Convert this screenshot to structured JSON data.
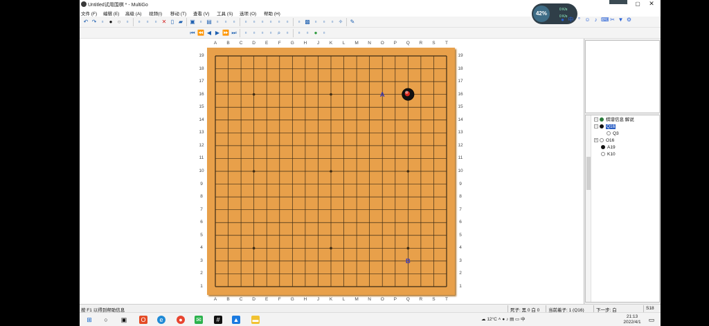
{
  "window": {
    "title": "Untitled试用围棋 * - MultiGo",
    "close_glyph": "✕"
  },
  "menu": [
    {
      "label": "文件 (F)"
    },
    {
      "label": "编辑 (E)"
    },
    {
      "label": "高级 (A)"
    },
    {
      "label": "视频(I)"
    },
    {
      "label": "移动 (T)"
    },
    {
      "label": "查看 (V)"
    },
    {
      "label": "工具 (S)"
    },
    {
      "label": "选项 (O)"
    },
    {
      "label": "帮助 (H)"
    }
  ],
  "toolbar1_icons": [
    "undo-icon",
    "redo-icon",
    "select-stone-icon",
    "black-stone-icon",
    "white-stone-icon",
    "alternate-icon",
    "erase-icon",
    "hand-icon",
    "mark-icon",
    "delete-icon",
    "new-icon",
    "open-icon",
    "save-icon",
    "save-as-icon",
    "print-icon",
    "print-preview-icon",
    "export-icon",
    "copy-icon",
    "paste-icon",
    "cut-icon",
    "puzzle-icon",
    "info-icon",
    "board-frame-icon",
    "board-grid-icon",
    "board-empty-icon",
    "lock-icon",
    "tree-view-icon",
    "list-view-icon",
    "split-view-icon",
    "tools-icon",
    "brush-icon"
  ],
  "toolbar2_icons": [
    "go-first-icon",
    "prev-10-icon",
    "prev-icon",
    "next-icon",
    "next-10-icon",
    "go-last-icon",
    "var-prev-icon",
    "var-next-icon",
    "var-up-icon",
    "var-down-icon",
    "find-icon",
    "find-next-icon",
    "find-prev-icon",
    "find-all-icon",
    "green-ball-icon",
    "settings-ball-icon"
  ],
  "board": {
    "size": 19,
    "columns": [
      "A",
      "B",
      "C",
      "D",
      "E",
      "F",
      "G",
      "H",
      "J",
      "K",
      "L",
      "M",
      "N",
      "O",
      "P",
      "Q",
      "R",
      "S",
      "T"
    ],
    "rows": [
      "19",
      "18",
      "17",
      "16",
      "15",
      "14",
      "13",
      "12",
      "11",
      "10",
      "9",
      "8",
      "7",
      "6",
      "5",
      "4",
      "3",
      "2",
      "1"
    ],
    "hoshi": [
      "D16",
      "K16",
      "Q16",
      "D10",
      "K10",
      "Q10",
      "D4",
      "K4",
      "Q4"
    ],
    "stones": [
      {
        "point": "Q16",
        "color": "black",
        "last_move": true
      }
    ],
    "labels": [
      {
        "point": "O16",
        "text": "A"
      },
      {
        "point": "Q3",
        "text": "B"
      }
    ],
    "line_color": "#3a2a15",
    "wood_color": "#e8a04a",
    "label_color": "#3d3ab8"
  },
  "tree": {
    "root": "棋谱信息 解说",
    "nodes": [
      {
        "label": "Q16",
        "stone": "black",
        "selected": true,
        "expanded": true
      },
      {
        "label": "Q3",
        "stone": "white",
        "child": true
      },
      {
        "label": "O16",
        "stone": "white",
        "expandable": true
      },
      {
        "label": "A19",
        "stone": "black"
      },
      {
        "label": "K10",
        "stone": "white"
      }
    ]
  },
  "status": {
    "help": "按 F1 以得到帮助信息",
    "captures": "死子: 黑 0 白 0",
    "current": "当前着子: 1 (Q16)",
    "next": "下一步: 白",
    "extra": "S18"
  },
  "overlay": {
    "cpu": "42%",
    "up": "0 K/s",
    "down": "0 K/s"
  },
  "taskbar": {
    "weather": "12°C",
    "time": "21:13",
    "date": "2022/4/1"
  }
}
